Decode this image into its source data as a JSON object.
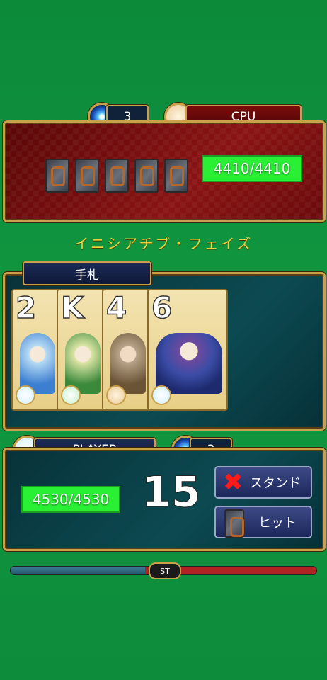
{
  "cpu": {
    "orb_count": "3",
    "name": "CPU",
    "hp": "4410/4410",
    "hidden_cards": [
      1,
      2,
      3,
      4,
      5
    ]
  },
  "phase": "イニシアチブ・フェイズ",
  "hand": {
    "title": "手札",
    "cards": [
      {
        "rank": "2",
        "element": "water",
        "color": "#b8dcf5"
      },
      {
        "rank": "K",
        "element": "wind",
        "color": "#dfe6a6"
      },
      {
        "rank": "4",
        "element": "earth",
        "color": "#b8a489"
      },
      {
        "rank": "6",
        "element": "water",
        "color": "#3b4ca6"
      }
    ]
  },
  "player": {
    "name": "PLAYER",
    "orb_count": "3",
    "hp": "4530/4530",
    "score": "15",
    "stand_label": "スタンド",
    "hit_label": "ヒット"
  },
  "stamina": {
    "label": "ST",
    "fill_fraction": 0.44
  },
  "colors": {
    "hp_green": "#29f034",
    "frame_gold": "#c9a14a",
    "cpu_red": "#8a1414",
    "panel_teal": "#0c4a51"
  }
}
